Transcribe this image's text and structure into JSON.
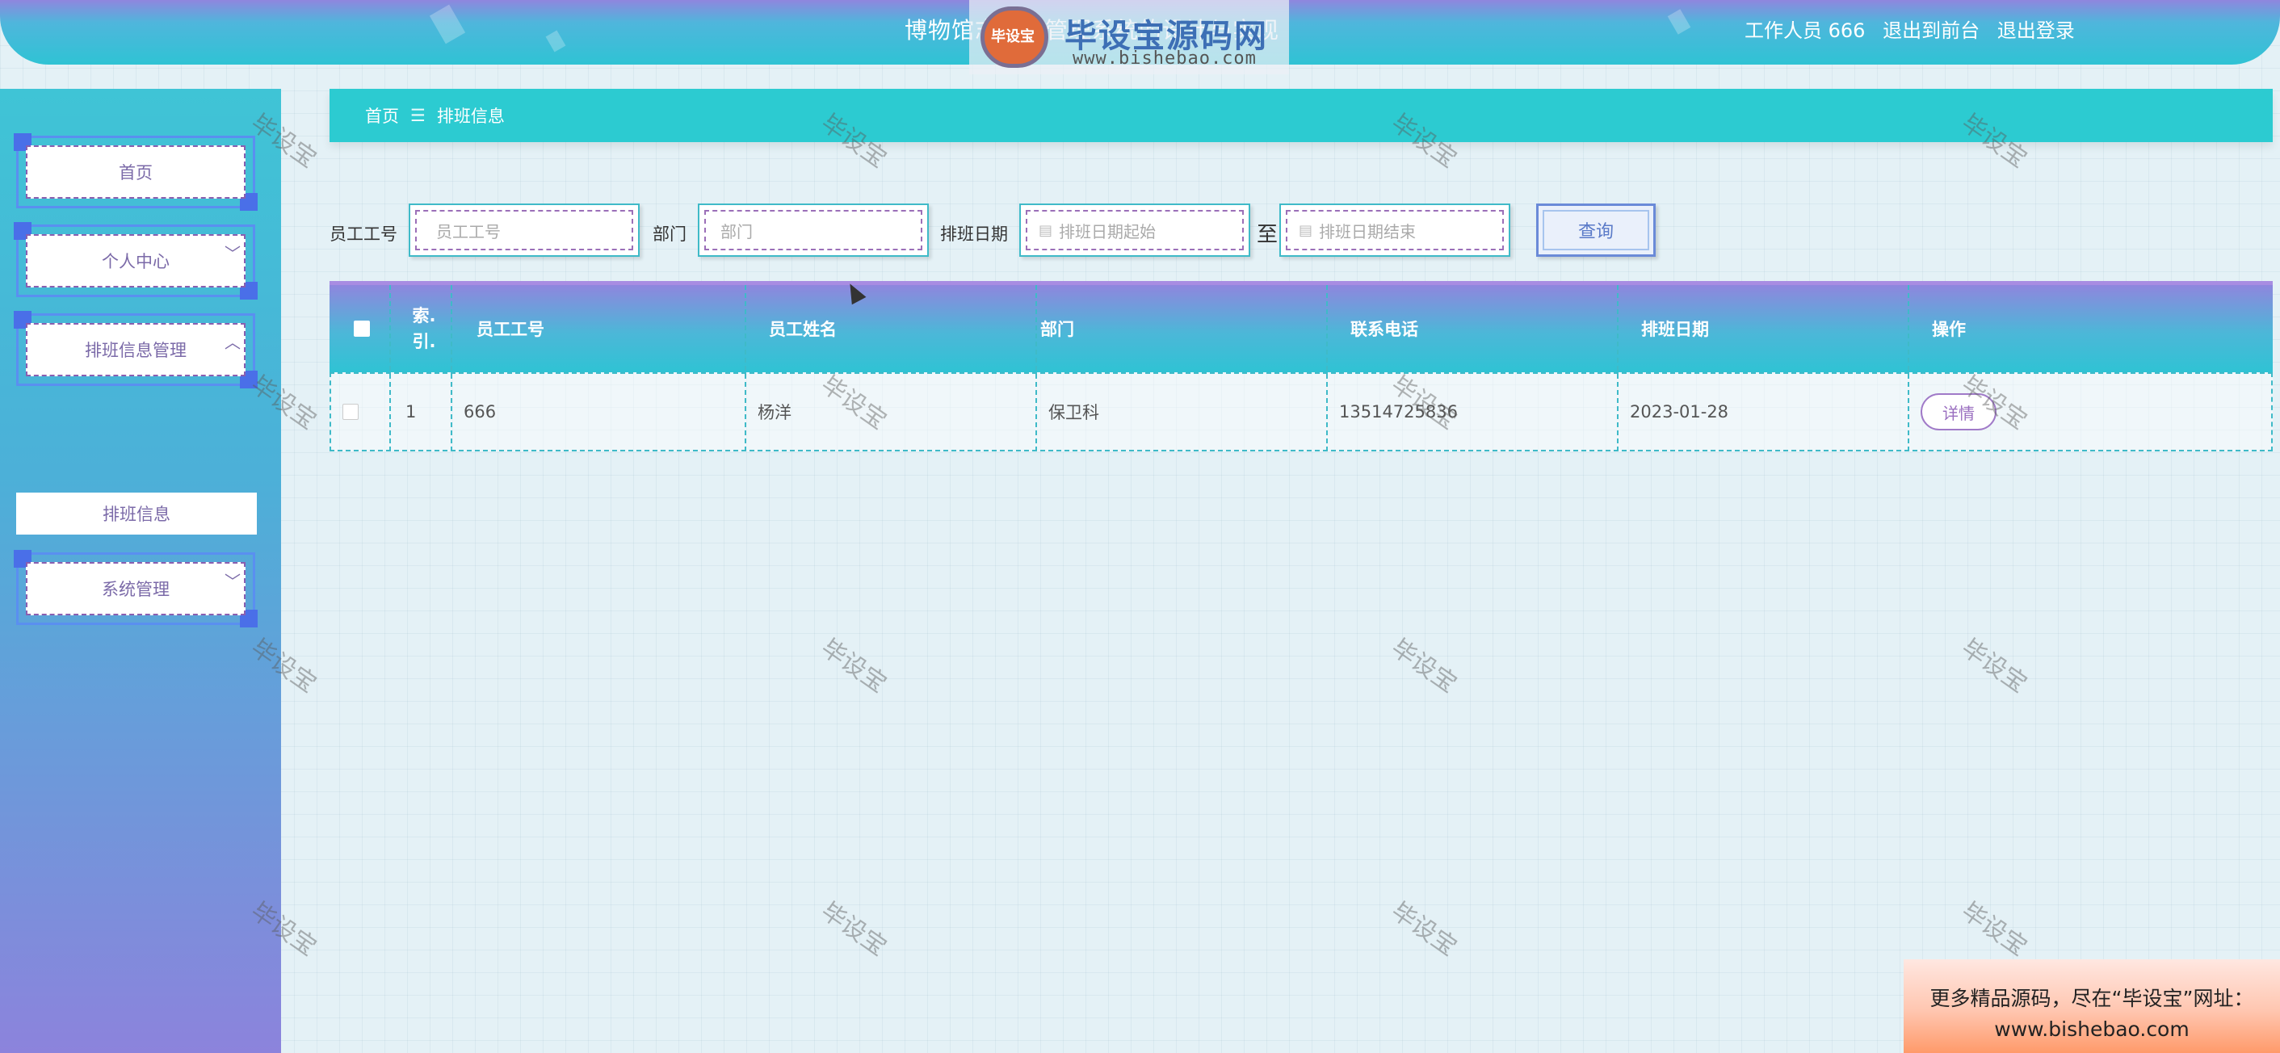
{
  "header": {
    "title": "博物馆志愿者管理系统的设计与实现",
    "watermark_logo": {
      "emblem_text": "毕设宝",
      "name": "毕设宝源码网",
      "url": "www.bishebao.com"
    },
    "user_label": "工作人员 666",
    "to_frontend": "退出到前台",
    "logout": "退出登录"
  },
  "sidebar": {
    "items": [
      {
        "label": "首页",
        "has_arrow": false
      },
      {
        "label": "个人中心",
        "has_arrow": true,
        "arrow": "﹀"
      },
      {
        "label": "排班信息管理",
        "has_arrow": true,
        "arrow": "︿",
        "expanded": true
      },
      {
        "label": "系统管理",
        "has_arrow": true,
        "arrow": "﹀"
      }
    ],
    "submenu": {
      "label": "排班信息",
      "active": true
    }
  },
  "breadcrumb": {
    "home": "首页",
    "separator": "☰",
    "current": "排班信息"
  },
  "search": {
    "employee_no_label": "员工工号",
    "employee_no_placeholder": "员工工号",
    "department_label": "部门",
    "department_placeholder": "部门",
    "date_label": "排班日期",
    "date_start_placeholder": "排班日期起始",
    "date_end_placeholder": "排班日期结束",
    "to_label": "至",
    "query_button": "查询",
    "calendar_icon": "▤"
  },
  "table": {
    "headers": [
      "索引",
      "员工工号",
      "员工姓名",
      "部门",
      "联系电话",
      "排班日期",
      "操作"
    ],
    "index_header_lines": [
      "索.",
      "引."
    ],
    "rows": [
      {
        "index": "1",
        "employee_no": "666",
        "employee_name": "杨洋",
        "department": "保卫科",
        "phone": "13514725836",
        "schedule_date": "2023-01-28",
        "action": "详情"
      }
    ]
  },
  "watermark_text": "毕设宝",
  "promo": {
    "line1": "更多精品源码，尽在“毕设宝”网址：",
    "line2": "www.bishebao.com"
  },
  "colors": {
    "teal": "#2ccbd1",
    "purple": "#8f86de",
    "accent_border": "#3fbac8"
  }
}
